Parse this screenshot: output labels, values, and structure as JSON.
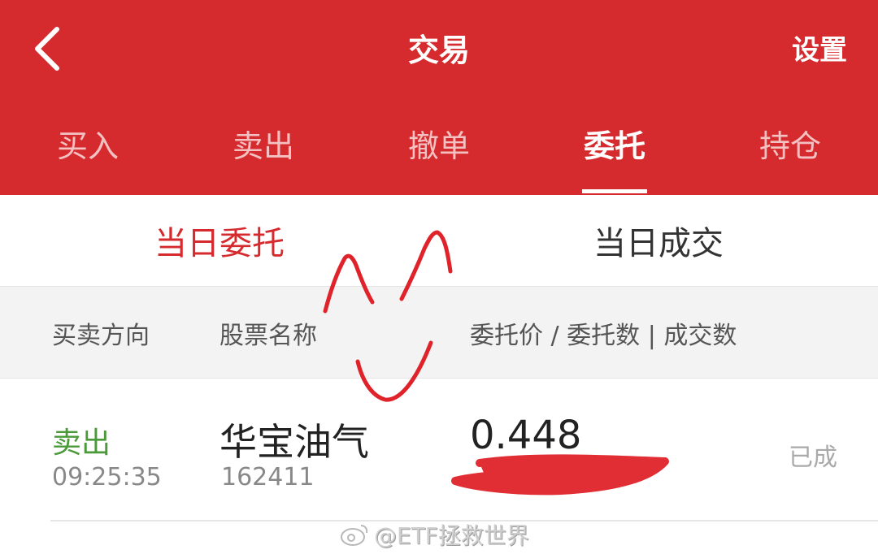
{
  "header": {
    "title": "交易",
    "settings_label": "设置"
  },
  "tabs": [
    {
      "label": "买入",
      "active": false
    },
    {
      "label": "卖出",
      "active": false
    },
    {
      "label": "撤单",
      "active": false
    },
    {
      "label": "委托",
      "active": true
    },
    {
      "label": "持仓",
      "active": false
    }
  ],
  "subtabs": [
    {
      "label": "当日委托",
      "active": true
    },
    {
      "label": "当日成交",
      "active": false
    }
  ],
  "table": {
    "columns": [
      "买卖方向",
      "股票名称",
      "委托价 / 委托数 | 成交数"
    ],
    "rows": [
      {
        "direction": "卖出",
        "time": "09:25:35",
        "stock_name": "华宝油气",
        "stock_code": "162411",
        "price": "0.448",
        "status": "已成"
      }
    ]
  },
  "watermark": "@ETF拯救世界",
  "colors": {
    "brand_red": "#d62b2e",
    "sell_green": "#4a9a3a",
    "scribble_red": "#e0232a"
  }
}
